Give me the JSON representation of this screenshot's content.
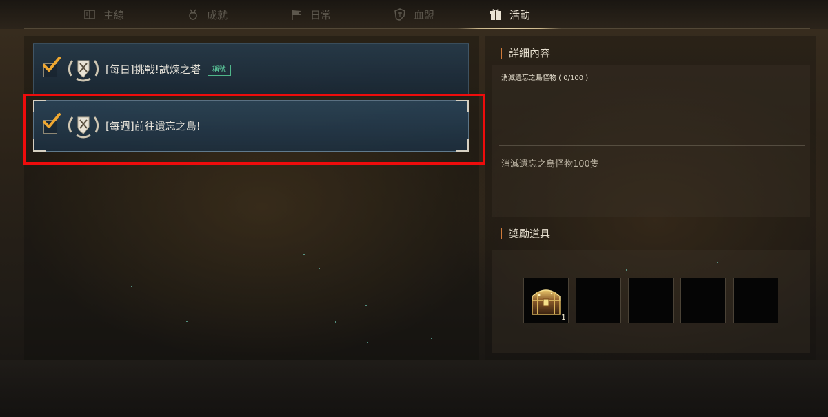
{
  "tabs": [
    {
      "label": "主線",
      "icon": "book-icon",
      "active": false
    },
    {
      "label": "成就",
      "icon": "medal-icon",
      "active": false
    },
    {
      "label": "日常",
      "icon": "flag-icon",
      "active": false
    },
    {
      "label": "血盟",
      "icon": "shield-icon",
      "active": false
    },
    {
      "label": "活動",
      "icon": "gift-icon",
      "active": true
    }
  ],
  "quests": [
    {
      "title": "[每日]挑戰!試煉之塔",
      "badge": "稱號",
      "checked": true,
      "selected": false
    },
    {
      "title": "[每週]前往遺忘之島!",
      "badge": "",
      "checked": true,
      "selected": true
    }
  ],
  "detail": {
    "header": "詳細內容",
    "progress": "消滅遺忘之島怪物 ( 0/100 )",
    "description": "消滅遺忘之島怪物100隻"
  },
  "reward": {
    "header": "獎勵道具",
    "slots": [
      {
        "item": "treasure-chest-icon",
        "quantity": "1"
      },
      {
        "item": "",
        "quantity": ""
      },
      {
        "item": "",
        "quantity": ""
      },
      {
        "item": "",
        "quantity": ""
      },
      {
        "item": "",
        "quantity": ""
      }
    ]
  },
  "colors": {
    "accent": "#d07a3a",
    "highlight": "#ee0c0c",
    "badge": "#5fd0a0",
    "check": "#f0a830"
  }
}
